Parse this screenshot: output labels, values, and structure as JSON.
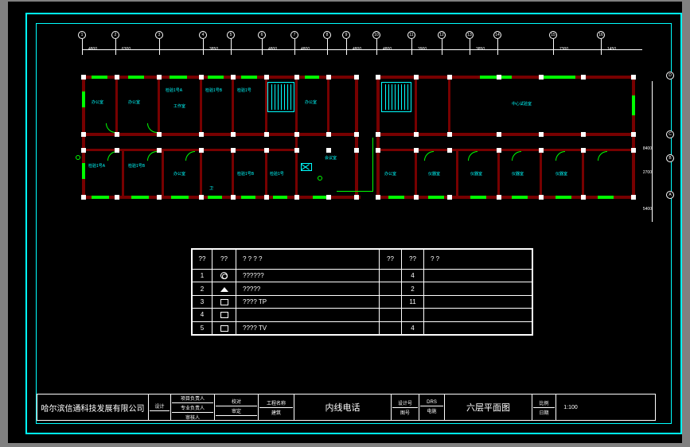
{
  "grid": {
    "cols": [
      "1",
      "2",
      "3",
      "4",
      "5",
      "6",
      "7",
      "8",
      "9",
      "10",
      "11",
      "12",
      "13",
      "14",
      "15",
      "16"
    ],
    "col_x": [
      28,
      70,
      125,
      180,
      215,
      254,
      295,
      336,
      360,
      398,
      442,
      480,
      515,
      550,
      620,
      680
    ],
    "col_dims": [
      "4800",
      "6300",
      "",
      "3850",
      "",
      "4800",
      "4800",
      "",
      "4800",
      "4800",
      "3900",
      "",
      "3850",
      "",
      "7300",
      "1450"
    ],
    "rows": [
      "D",
      "C",
      "B",
      "A"
    ],
    "row_y": [
      38,
      112,
      142,
      188
    ],
    "row_dims": [
      "",
      "8400",
      "2700",
      "5400"
    ]
  },
  "rooms": {
    "r1": "办公室",
    "r2": "办公室",
    "r3": "检验1号A",
    "r4": "工作室",
    "r5": "检验1号B",
    "r6": "办公室",
    "r7": "检验1号",
    "r8": "中心试验室",
    "r9": "检验1号A",
    "r10": "检验1号B",
    "r11": "办公室",
    "r12": "检验1号B",
    "r13": "卫",
    "r14": "会议室",
    "r15": "检验1号",
    "r16": "办公室",
    "r17": "仪器室",
    "r18": "仪器室",
    "r19": "仪器室",
    "r20": "仪器室"
  },
  "legend": {
    "headers": {
      "c1": "??",
      "c2": "??",
      "c3": "?    ?    ?    ?",
      "c4": "??",
      "c5": "??",
      "c6": "?          ?"
    },
    "rows": [
      {
        "n": "1",
        "sym": "circ",
        "desc": "??????",
        "u": "",
        "q": "4",
        "note": ""
      },
      {
        "n": "2",
        "sym": "tri",
        "desc": "?????",
        "u": "",
        "q": "2",
        "note": ""
      },
      {
        "n": "3",
        "sym": "ico",
        "desc": "????  TP",
        "u": "",
        "q": "11",
        "note": ""
      },
      {
        "n": "4",
        "sym": "ico",
        "desc": "",
        "u": "",
        "q": "",
        "note": ""
      },
      {
        "n": "5",
        "sym": "ico",
        "desc": "????  TV",
        "u": "",
        "q": "4",
        "note": ""
      }
    ]
  },
  "titleblock": {
    "company": "哈尔滨信通科技发展有限公司",
    "col1": {
      "a": "设计",
      "b": ""
    },
    "col2": {
      "a": "项目负责人",
      "b": "专业负责人",
      "c": "审核人"
    },
    "col3": {
      "a": "校对",
      "b": "审定",
      "c": ""
    },
    "col4": {
      "a": "工程名称",
      "b": "建筑"
    },
    "project": "内线电话",
    "col5": {
      "a": "设计号",
      "b": "图号"
    },
    "col6": {
      "a": "DRS",
      "b": "电施"
    },
    "drawing": "六层平面图",
    "col7": {
      "a": "比例",
      "b": "日期"
    },
    "scale": "1:100"
  }
}
